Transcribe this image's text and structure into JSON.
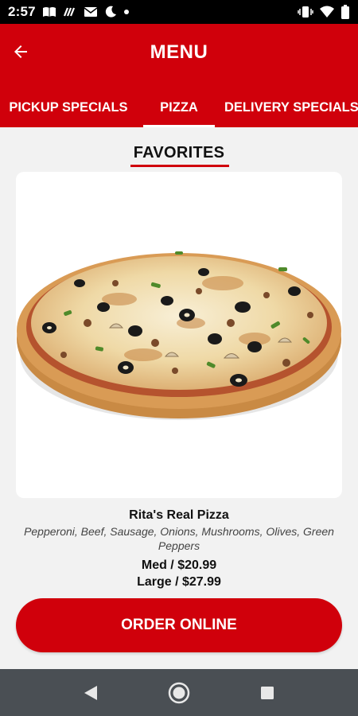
{
  "status_bar": {
    "time": "2:57"
  },
  "app_bar": {
    "title": "MENU",
    "back_icon": "arrow-left-icon"
  },
  "tabs": [
    {
      "label": "PICKUP SPECIALS",
      "active": false
    },
    {
      "label": "PIZZA",
      "active": true
    },
    {
      "label": "DELIVERY SPECIALS",
      "active": false
    }
  ],
  "section": {
    "title": "FAVORITES"
  },
  "item": {
    "name": "Rita's Real Pizza",
    "description": "Pepperoni, Beef, Sausage, Onions, Mushrooms, Olives, Green Peppers",
    "prices": [
      "Med / $20.99",
      "Large / $27.99"
    ]
  },
  "order_button": {
    "label": "ORDER ONLINE"
  },
  "colors": {
    "brand_red": "#d0000b",
    "nav_bar": "#4a4f54"
  }
}
